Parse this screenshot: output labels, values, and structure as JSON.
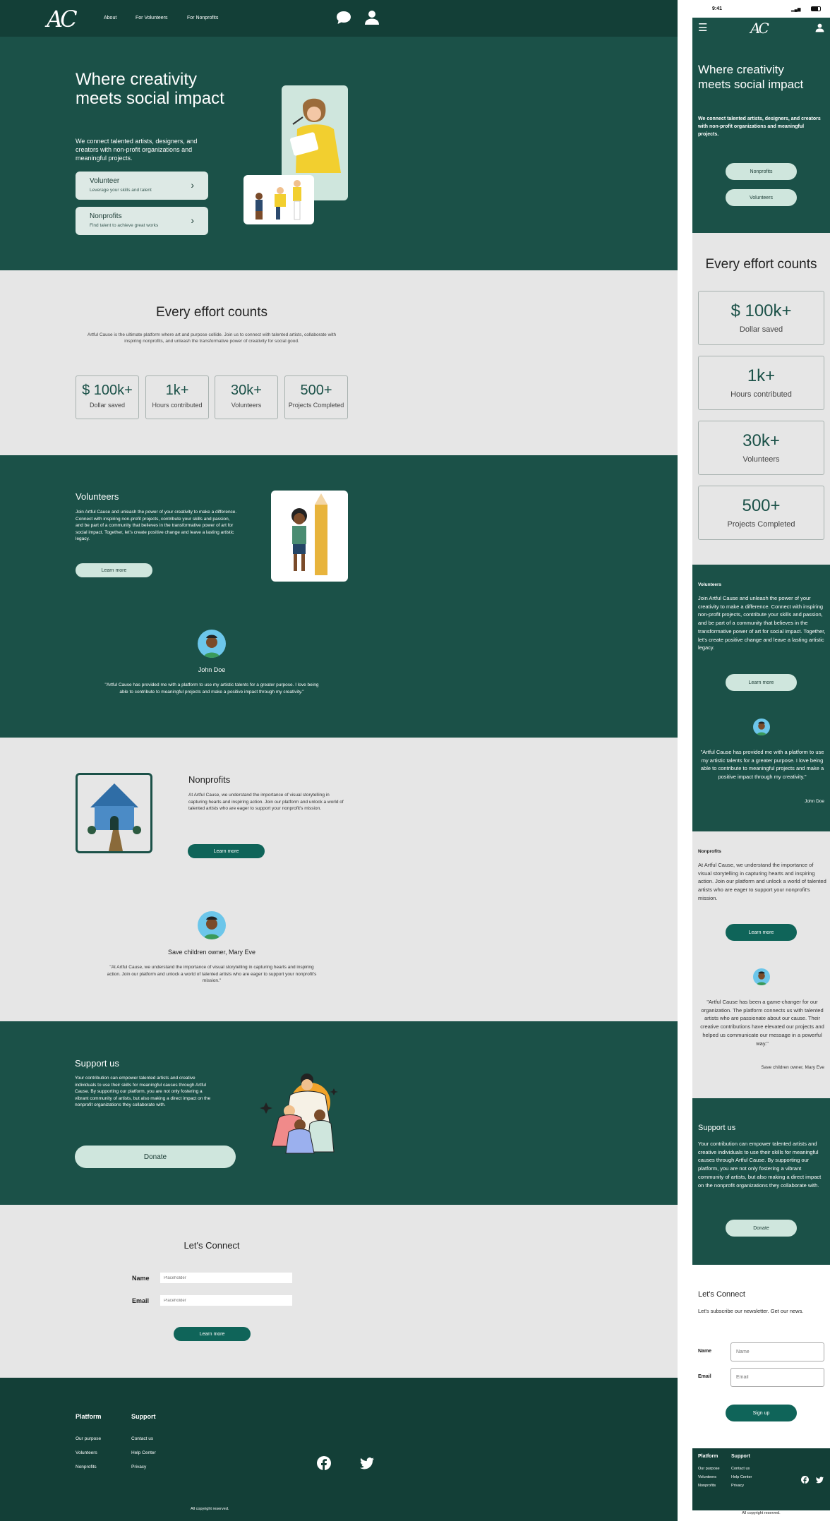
{
  "brand": {
    "logo": "AC"
  },
  "nav": {
    "about": "About",
    "volunteers": "For Volunteers",
    "nonprofits": "For Nonprofits"
  },
  "hero": {
    "title": "Where creativity meets social impact",
    "subtitle": "We connect talented artists, designers, and creators with non-profit organizations and meaningful projects.",
    "cards": [
      {
        "title": "Volunteer",
        "desc": "Leverage your skills and talent"
      },
      {
        "title": "Nonprofits",
        "desc": "Find talent to achieve great works"
      }
    ]
  },
  "effort": {
    "title": "Every effort counts",
    "desc": "Artful Cause is the ultimate platform where art and purpose collide. Join us to connect with talented artists, collaborate with inspiring nonprofits, and unleash the transformative power of creativity for social good.",
    "stats": [
      {
        "value": "$ 100k+",
        "label": "Dollar saved"
      },
      {
        "value": "1k+",
        "label": "Hours contributed"
      },
      {
        "value": "30k+",
        "label": "Volunteers"
      },
      {
        "value": "500+",
        "label": "Projects Completed"
      }
    ]
  },
  "volunteers": {
    "title": "Volunteers",
    "desc": "Join Artful Cause and unleash the power of your creativity to make a difference. Connect with inspiring non-profit projects, contribute your skills and passion, and be part of a community that believes in the transformative power of art for social impact. Together, let's create positive change and leave a lasting artistic legacy.",
    "button": "Learn more",
    "testimonial": {
      "name": "John Doe",
      "quote": "\"Artful Cause has provided me with a platform to use my artistic talents for a greater purpose. I love being able to contribute to meaningful projects and make a positive impact through my creativity.\""
    }
  },
  "nonprofits": {
    "title": "Nonprofits",
    "desc": "At Artful Cause, we understand the importance of visual storytelling in capturing hearts and inspiring action. Join our platform and unlock a world of talented artists who are eager to support your nonprofit's mission.",
    "button": "Learn more",
    "testimonial": {
      "name": "Save children owner, Mary Eve",
      "quote": "\"At Artful Cause, we understand the importance of visual storytelling in capturing hearts and inspiring action. Join our platform and unlock a world of talented artists who are eager to support your nonprofit's mission.\""
    }
  },
  "support": {
    "title": "Support us",
    "desc": "Your contribution can empower talented artists and creative individuals to use their skills for meaningful causes through Artful Cause. By supporting our platform, you are not only fostering a vibrant community of artists, but also making a direct impact on the nonprofit organizations they collaborate with.",
    "button": "Donate"
  },
  "connect": {
    "title": "Let's Connect",
    "name_label": "Name",
    "email_label": "Email",
    "placeholder": "Placeholder",
    "button": "Learn more"
  },
  "footer": {
    "platform_title": "Platform",
    "platform_links": [
      "Our purpose",
      "Volunteers",
      "Nonprofits"
    ],
    "support_title": "Support",
    "support_links": [
      "Contact us",
      "Help Center",
      "Privacy"
    ],
    "copyright": "All copyright reserved."
  },
  "mobile": {
    "time": "9:41",
    "hero_buttons": [
      "Nonprofits",
      "Volunteers"
    ],
    "volunteers_quote": "\"Artful Cause has provided me with a platform to use my artistic talents for a greater purpose. I love being able to contribute to meaningful projects and make a positive impact through my creativity.\"",
    "volunteers_author": "John Doe",
    "nonprofits_quote": "\"Artful Cause has been a game-changer for our organization. The platform connects us with talented artists who are passionate about our cause. Their creative contributions have elevated our projects and helped us communicate our message in a powerful way.\"",
    "nonprofits_author": "Save children owner, Mary Eve",
    "newsletter": "Let's subscribe our newsletter. Get our news.",
    "name_placeholder": "Name",
    "email_placeholder": "Email",
    "signup": "Sign up"
  },
  "colors": {
    "dark_green": "#1b5148",
    "footer_green": "#133f37",
    "light_gray": "#e6e6e6",
    "mint": "#cfe6dd",
    "teal_button": "#0f6459"
  }
}
